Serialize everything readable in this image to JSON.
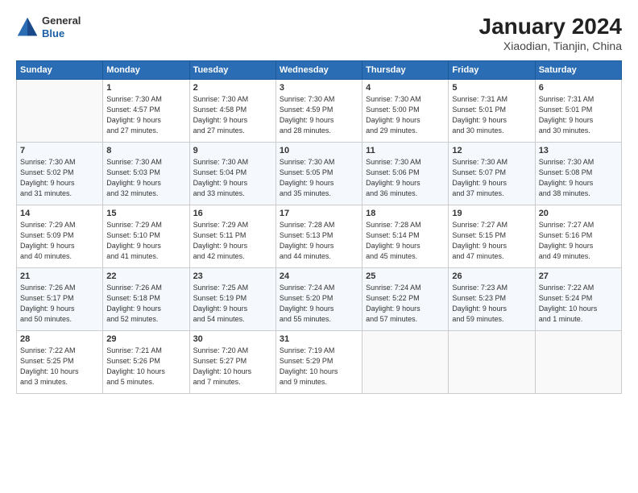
{
  "header": {
    "logo_line1": "General",
    "logo_line2": "Blue",
    "title": "January 2024",
    "subtitle": "Xiaodian, Tianjin, China"
  },
  "days_of_week": [
    "Sunday",
    "Monday",
    "Tuesday",
    "Wednesday",
    "Thursday",
    "Friday",
    "Saturday"
  ],
  "weeks": [
    [
      {
        "day": "",
        "info": ""
      },
      {
        "day": "1",
        "info": "Sunrise: 7:30 AM\nSunset: 4:57 PM\nDaylight: 9 hours\nand 27 minutes."
      },
      {
        "day": "2",
        "info": "Sunrise: 7:30 AM\nSunset: 4:58 PM\nDaylight: 9 hours\nand 27 minutes."
      },
      {
        "day": "3",
        "info": "Sunrise: 7:30 AM\nSunset: 4:59 PM\nDaylight: 9 hours\nand 28 minutes."
      },
      {
        "day": "4",
        "info": "Sunrise: 7:30 AM\nSunset: 5:00 PM\nDaylight: 9 hours\nand 29 minutes."
      },
      {
        "day": "5",
        "info": "Sunrise: 7:31 AM\nSunset: 5:01 PM\nDaylight: 9 hours\nand 30 minutes."
      },
      {
        "day": "6",
        "info": "Sunrise: 7:31 AM\nSunset: 5:01 PM\nDaylight: 9 hours\nand 30 minutes."
      }
    ],
    [
      {
        "day": "7",
        "info": "Sunrise: 7:30 AM\nSunset: 5:02 PM\nDaylight: 9 hours\nand 31 minutes."
      },
      {
        "day": "8",
        "info": "Sunrise: 7:30 AM\nSunset: 5:03 PM\nDaylight: 9 hours\nand 32 minutes."
      },
      {
        "day": "9",
        "info": "Sunrise: 7:30 AM\nSunset: 5:04 PM\nDaylight: 9 hours\nand 33 minutes."
      },
      {
        "day": "10",
        "info": "Sunrise: 7:30 AM\nSunset: 5:05 PM\nDaylight: 9 hours\nand 35 minutes."
      },
      {
        "day": "11",
        "info": "Sunrise: 7:30 AM\nSunset: 5:06 PM\nDaylight: 9 hours\nand 36 minutes."
      },
      {
        "day": "12",
        "info": "Sunrise: 7:30 AM\nSunset: 5:07 PM\nDaylight: 9 hours\nand 37 minutes."
      },
      {
        "day": "13",
        "info": "Sunrise: 7:30 AM\nSunset: 5:08 PM\nDaylight: 9 hours\nand 38 minutes."
      }
    ],
    [
      {
        "day": "14",
        "info": "Sunrise: 7:29 AM\nSunset: 5:09 PM\nDaylight: 9 hours\nand 40 minutes."
      },
      {
        "day": "15",
        "info": "Sunrise: 7:29 AM\nSunset: 5:10 PM\nDaylight: 9 hours\nand 41 minutes."
      },
      {
        "day": "16",
        "info": "Sunrise: 7:29 AM\nSunset: 5:11 PM\nDaylight: 9 hours\nand 42 minutes."
      },
      {
        "day": "17",
        "info": "Sunrise: 7:28 AM\nSunset: 5:13 PM\nDaylight: 9 hours\nand 44 minutes."
      },
      {
        "day": "18",
        "info": "Sunrise: 7:28 AM\nSunset: 5:14 PM\nDaylight: 9 hours\nand 45 minutes."
      },
      {
        "day": "19",
        "info": "Sunrise: 7:27 AM\nSunset: 5:15 PM\nDaylight: 9 hours\nand 47 minutes."
      },
      {
        "day": "20",
        "info": "Sunrise: 7:27 AM\nSunset: 5:16 PM\nDaylight: 9 hours\nand 49 minutes."
      }
    ],
    [
      {
        "day": "21",
        "info": "Sunrise: 7:26 AM\nSunset: 5:17 PM\nDaylight: 9 hours\nand 50 minutes."
      },
      {
        "day": "22",
        "info": "Sunrise: 7:26 AM\nSunset: 5:18 PM\nDaylight: 9 hours\nand 52 minutes."
      },
      {
        "day": "23",
        "info": "Sunrise: 7:25 AM\nSunset: 5:19 PM\nDaylight: 9 hours\nand 54 minutes."
      },
      {
        "day": "24",
        "info": "Sunrise: 7:24 AM\nSunset: 5:20 PM\nDaylight: 9 hours\nand 55 minutes."
      },
      {
        "day": "25",
        "info": "Sunrise: 7:24 AM\nSunset: 5:22 PM\nDaylight: 9 hours\nand 57 minutes."
      },
      {
        "day": "26",
        "info": "Sunrise: 7:23 AM\nSunset: 5:23 PM\nDaylight: 9 hours\nand 59 minutes."
      },
      {
        "day": "27",
        "info": "Sunrise: 7:22 AM\nSunset: 5:24 PM\nDaylight: 10 hours\nand 1 minute."
      }
    ],
    [
      {
        "day": "28",
        "info": "Sunrise: 7:22 AM\nSunset: 5:25 PM\nDaylight: 10 hours\nand 3 minutes."
      },
      {
        "day": "29",
        "info": "Sunrise: 7:21 AM\nSunset: 5:26 PM\nDaylight: 10 hours\nand 5 minutes."
      },
      {
        "day": "30",
        "info": "Sunrise: 7:20 AM\nSunset: 5:27 PM\nDaylight: 10 hours\nand 7 minutes."
      },
      {
        "day": "31",
        "info": "Sunrise: 7:19 AM\nSunset: 5:29 PM\nDaylight: 10 hours\nand 9 minutes."
      },
      {
        "day": "",
        "info": ""
      },
      {
        "day": "",
        "info": ""
      },
      {
        "day": "",
        "info": ""
      }
    ]
  ]
}
